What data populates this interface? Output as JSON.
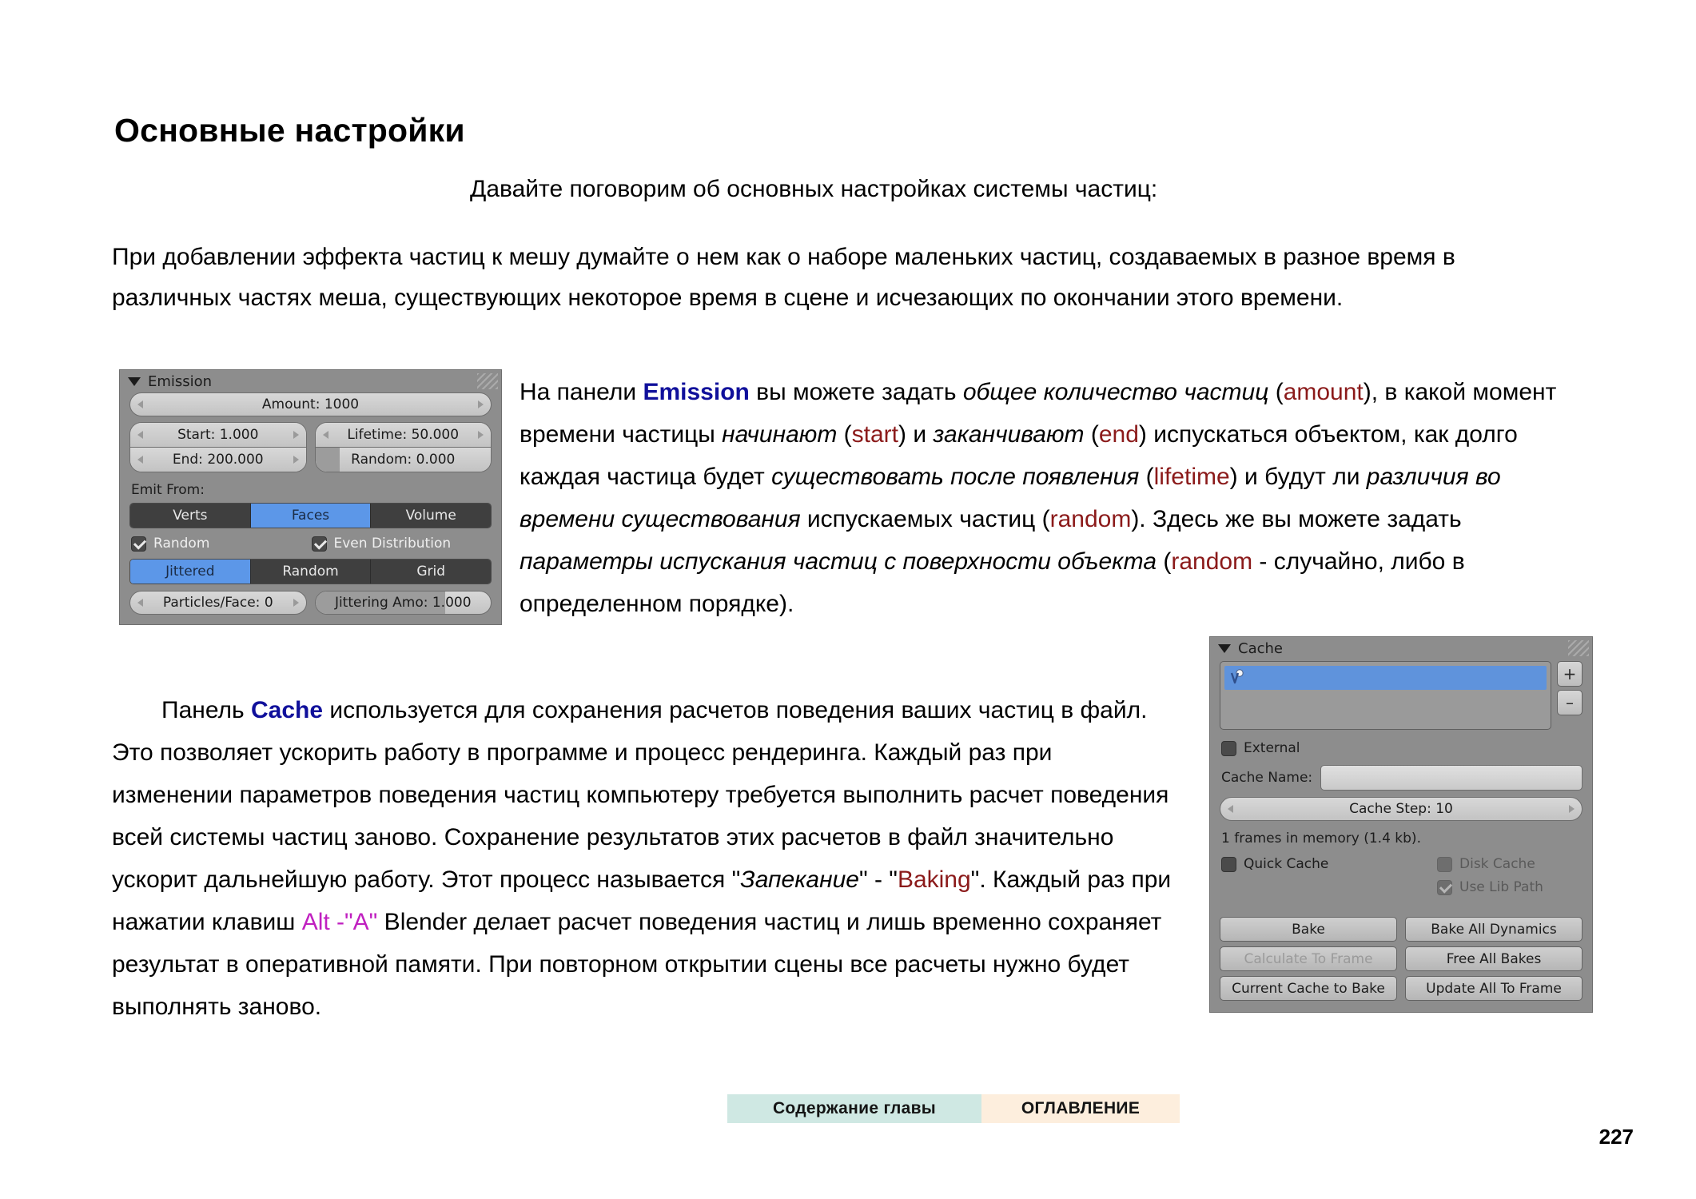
{
  "document": {
    "heading": "Основные настройки",
    "lead": "Давайте поговорим об основных настройках системы частиц:",
    "page_number": "227"
  },
  "paragraph_intro": {
    "line1": "При добавлении эффекта частиц к мешу думайте о нем как о наборе маленьких частиц, создаваемых в",
    "line2": "разное время в различных частях меша, существующих некоторое время в сцене и исчезающих по",
    "line3": "окончании этого времени."
  },
  "paragraph_emission": {
    "t1": "На панели ",
    "kw_emission": "Emission",
    "t2": " вы можете задать ",
    "i1": "общее количество частиц",
    "t3": " (",
    "kw_amount": "amount",
    "t4": "), в какой момент времени частицы ",
    "i2": "начинают",
    "t5": " (",
    "kw_start": "start",
    "t6": ") и ",
    "i3": "заканчивают",
    "t7": " (",
    "kw_end": "end",
    "t8": ") испускаться объектом, как долго каждая частица будет ",
    "i4": "существовать после появления",
    "t9": " (",
    "kw_lifetime": "lifetime",
    "t10": ") и будут ли ",
    "i5": "различия во времени существования",
    "t11": " испускаемых частиц (",
    "kw_random1": "random",
    "t12": "). Здесь же вы можете задать ",
    "i6": "параметры испускания частиц с поверхности объекта",
    "t13": " (",
    "kw_random2": "random",
    "t14": " - случайно, либо в определенном порядке)."
  },
  "paragraph_cache": {
    "t1": "Панель ",
    "kw_cache": "Cache",
    "t2": " используется для сохранения расчетов поведения ваших частиц в файл. Это позволяет ускорить работу в программе и процесс рендеринга. Каждый раз при изменении параметров поведения частиц компьютеру требуется выполнить расчет поведения всей системы частиц заново. Сохранение результатов этих расчетов в файл значительно ускорит дальнейшую работу. Этот процесс называется \"",
    "i1": "Запекание",
    "t3": "\" - \"",
    "kw_baking": "Baking",
    "t4": "\". Каждый раз при нажатии клавиш ",
    "kw_alt": "Alt -\"A\"",
    "t5": " Blender делает расчет поведения частиц и лишь временно сохраняет результат в оперативной памяти. При повторном открытии сцены все расчеты нужно будет выполнять заново."
  },
  "footer": {
    "chapter_button": "Содержание главы",
    "toc_button": "ОГЛАВЛЕНИЕ"
  },
  "emission_panel": {
    "title": "Emission",
    "amount": "Amount: 1000",
    "start": "Start: 1.000",
    "end": "End: 200.000",
    "lifetime": "Lifetime: 50.000",
    "random": "Random: 0.000",
    "emit_from_label": "Emit From:",
    "emit_from_options": [
      "Verts",
      "Faces",
      "Volume"
    ],
    "emit_from_selected": "Faces",
    "random_checkbox": "Random",
    "even_distribution_checkbox": "Even Distribution",
    "distribution_options": [
      "Jittered",
      "Random",
      "Grid"
    ],
    "distribution_selected": "Jittered",
    "particles_per_face": "Particles/Face: 0",
    "jittering_amount": "Jittering Amo: 1.000"
  },
  "cache_panel": {
    "title": "Cache",
    "add_button": "+",
    "remove_button": "–",
    "external_checkbox": "External",
    "cache_name_label": "Cache Name:",
    "cache_name_value": "",
    "cache_step": "Cache Step: 10",
    "memory_info": "1 frames in memory (1.4 kb).",
    "quick_cache_checkbox": "Quick Cache",
    "disk_cache_checkbox": "Disk Cache",
    "use_lib_path_checkbox": "Use Lib Path",
    "buttons": {
      "bake": "Bake",
      "bake_all_dynamics": "Bake All Dynamics",
      "calculate_to_frame": "Calculate To Frame",
      "free_all_bakes": "Free All Bakes",
      "current_cache_to_bake": "Current Cache to Bake",
      "update_all_to_frame": "Update All To Frame"
    }
  },
  "colors": {
    "keyword_blue": "#10109b",
    "keyword_red": "#8b1a1a",
    "keyword_magenta": "#c020c0",
    "panel_bg": "#8d8d8d",
    "accent_blue": "#5c97e8",
    "nav_chapter_bg": "#cfe8e3",
    "nav_toc_bg": "#fdeedd"
  }
}
